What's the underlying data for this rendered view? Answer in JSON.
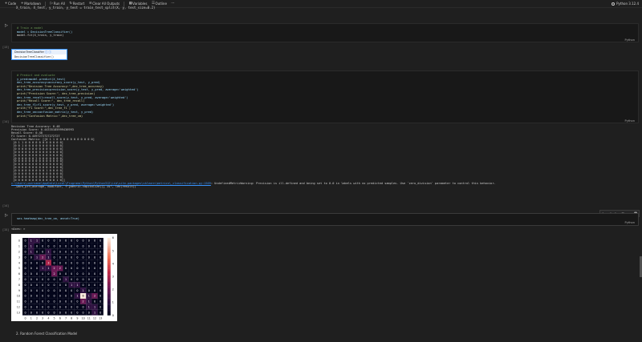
{
  "toolbar": {
    "items": [
      {
        "icon": "+",
        "label": "Code"
      },
      {
        "icon": "+",
        "label": "Markdown"
      },
      {
        "icon": "▷",
        "label": "Run All"
      },
      {
        "icon": "↻",
        "label": "Restart"
      },
      {
        "icon": "≡",
        "label": "Clear All Outputs"
      },
      {
        "icon": "▦",
        "label": "Variables"
      },
      {
        "icon": "☰",
        "label": "Outline"
      },
      {
        "icon": "···",
        "label": ""
      }
    ],
    "kernel": "Python 3.12.4"
  },
  "top_line": "X_train, X_test, y_train, y_test = train_test_split(X, y, test_size=0.2)",
  "cell1": {
    "lines": [
      "# Train a model",
      "model = DecisionTreeClassifier()",
      "model.fit(X_train, y_train)"
    ],
    "count": "[13]",
    "lang": "Python"
  },
  "dtc_output": {
    "header": "DecisionTreeClassifier",
    "body": "DecisionTreeClassifier()",
    "icons": "ⓘ ⓘ"
  },
  "cell2": {
    "lines": [
      "# Predict and evaluate",
      "y_pred=model.predict(X_test)",
      "dec_tree_accuracy=accuracy_score(y_test, y_pred)",
      "print(\"Decision Tree Accuracy:\",dec_tree_accuracy)",
      "dec_tree_precision=precision_score(y_test, y_pred, average='weighted')",
      "print(\"Precision Score:\", dec_tree_precision)",
      "dec_tree_recall=recall_score(y_test, y_pred, average='weighted')",
      "print(\"Recall Score:\", dec_tree_recall)",
      "dec_tree_f1=f1_score(y_test, y_pred, average='weighted')",
      "print(\"F1 Score:\",dec_tree_f1 )",
      "dec_tree_cm=confusion_matrix(y_test, y_pred)",
      "print(\"Confusion Matrix:\",dec_tree_cm)"
    ],
    "count": "[14]",
    "lang": "Python"
  },
  "output2": {
    "lines": [
      "Decision Tree Accuracy: 0.48",
      "Precision Score: 0.44335185999436993",
      "Recall Score: 0.48",
      "F1 Score: 0.4497272727272727",
      "Confusion Matrix: [[0 1 1 0 0 0 0 0 0 0 0 0 0 0]",
      " [0 1 1 0 0 0 0 0 0 0 0 0 0 0]",
      " [0 0 1 0 0 0 0 0 0 0 0 0 0 0]",
      " [0 0 0 0 0 0 0 0 0 0 0 0 0 0]",
      " [0 0 0 0 0 0 0 0 0 0 0 0 0 0]",
      " [0 0 0 0 0 0 0 0 0 0 0 0 0 0]",
      " [0 0 0 0 0 0 2 0 0 0 0 0 0 0]",
      " [0 0 0 0 0 0 0 0 0 0 0 0 0 0]",
      " [0 0 0 0 0 0 0 0 0 0 0 0 0 0]",
      " [0 0 0 0 0 0 0 0 0 0 0 0 0 0]",
      " [0 0 0 0 0 0 0 0 0 1 0 0 0 0]",
      " [0 0 0 0 0 0 0 0 0 0 0 0 0 0]",
      " [0 0 0 0 0 0 0 0 0 0 0 0 0 0]",
      " [0 0 0 0 0 0 0 0 0 0 0 0 1 0]]"
    ],
    "warning_link": "c:\\Users\\username\\AppData\\Local\\Programs\\Python\\Python312\\Lib\\site-packages\\sklearn\\metrics\\_classification.py:1509",
    "warning_text": ": UndefinedMetricWarning: Precision is ill-defined and being set to 0.0 in labels with no predicted samples. Use `zero_division` parameter to control this behavior.",
    "warning_line2": "  _warn_prf(average, modifier, f\"{metric.capitalize()} is\", len(result))",
    "count": "[14]"
  },
  "cell3": {
    "line": "sns.heatmap(dec_tree_cm, annot=True)",
    "count": "[15]",
    "lang": "Python"
  },
  "cellbar_icons": [
    "⊳",
    "⊲",
    "▷",
    "⊟",
    "···",
    "🗑"
  ],
  "output3": {
    "text": "<Axes: >",
    "count": "[15]"
  },
  "markdown": "2. Random Forest Classification Model",
  "chart_data": {
    "type": "heatmap",
    "x_ticks": [
      "0",
      "1",
      "2",
      "3",
      "4",
      "5",
      "6",
      "7",
      "8",
      "9",
      "10",
      "11",
      "12",
      "13"
    ],
    "y_ticks": [
      "0",
      "1",
      "2",
      "3",
      "4",
      "5",
      "6",
      "7",
      "8",
      "9",
      "10",
      "11",
      "12",
      "13"
    ],
    "values": [
      [
        0,
        1,
        1,
        0,
        0,
        0,
        0,
        0,
        0,
        0,
        0,
        0,
        0,
        0
      ],
      [
        0,
        1,
        0,
        0,
        0,
        0,
        0,
        0,
        0,
        0,
        0,
        0,
        0,
        0
      ],
      [
        0,
        1,
        0,
        0,
        1,
        0,
        0,
        0,
        0,
        0,
        0,
        0,
        0,
        0
      ],
      [
        0,
        0,
        1,
        2,
        1,
        0,
        0,
        0,
        0,
        0,
        0,
        0,
        0,
        0
      ],
      [
        0,
        0,
        0,
        0,
        3,
        0,
        0,
        0,
        0,
        0,
        0,
        0,
        0,
        0
      ],
      [
        0,
        0,
        0,
        1,
        1,
        2,
        2,
        0,
        0,
        0,
        0,
        0,
        0,
        0
      ],
      [
        0,
        0,
        0,
        0,
        0,
        2,
        0,
        0,
        0,
        0,
        0,
        0,
        0,
        0
      ],
      [
        0,
        0,
        0,
        0,
        0,
        0,
        0,
        1,
        0,
        0,
        0,
        0,
        0,
        0
      ],
      [
        0,
        0,
        0,
        0,
        0,
        0,
        0,
        0,
        1,
        1,
        0,
        0,
        0,
        0
      ],
      [
        0,
        0,
        0,
        0,
        0,
        0,
        0,
        0,
        0,
        0,
        1,
        0,
        0,
        0
      ],
      [
        0,
        0,
        0,
        0,
        0,
        0,
        0,
        0,
        0,
        1,
        6,
        1,
        2,
        0
      ],
      [
        0,
        0,
        0,
        0,
        0,
        0,
        0,
        0,
        0,
        0,
        2,
        1,
        0,
        0
      ],
      [
        0,
        0,
        0,
        0,
        0,
        0,
        0,
        0,
        0,
        0,
        0,
        1,
        1,
        0
      ],
      [
        0,
        0,
        0,
        0,
        0,
        0,
        0,
        0,
        0,
        0,
        0,
        0,
        1,
        0
      ]
    ],
    "colorbar_ticks": [
      "0",
      "1",
      "2",
      "3",
      "4",
      "5",
      "6"
    ],
    "vmin": 0,
    "vmax": 6,
    "annot": true
  }
}
